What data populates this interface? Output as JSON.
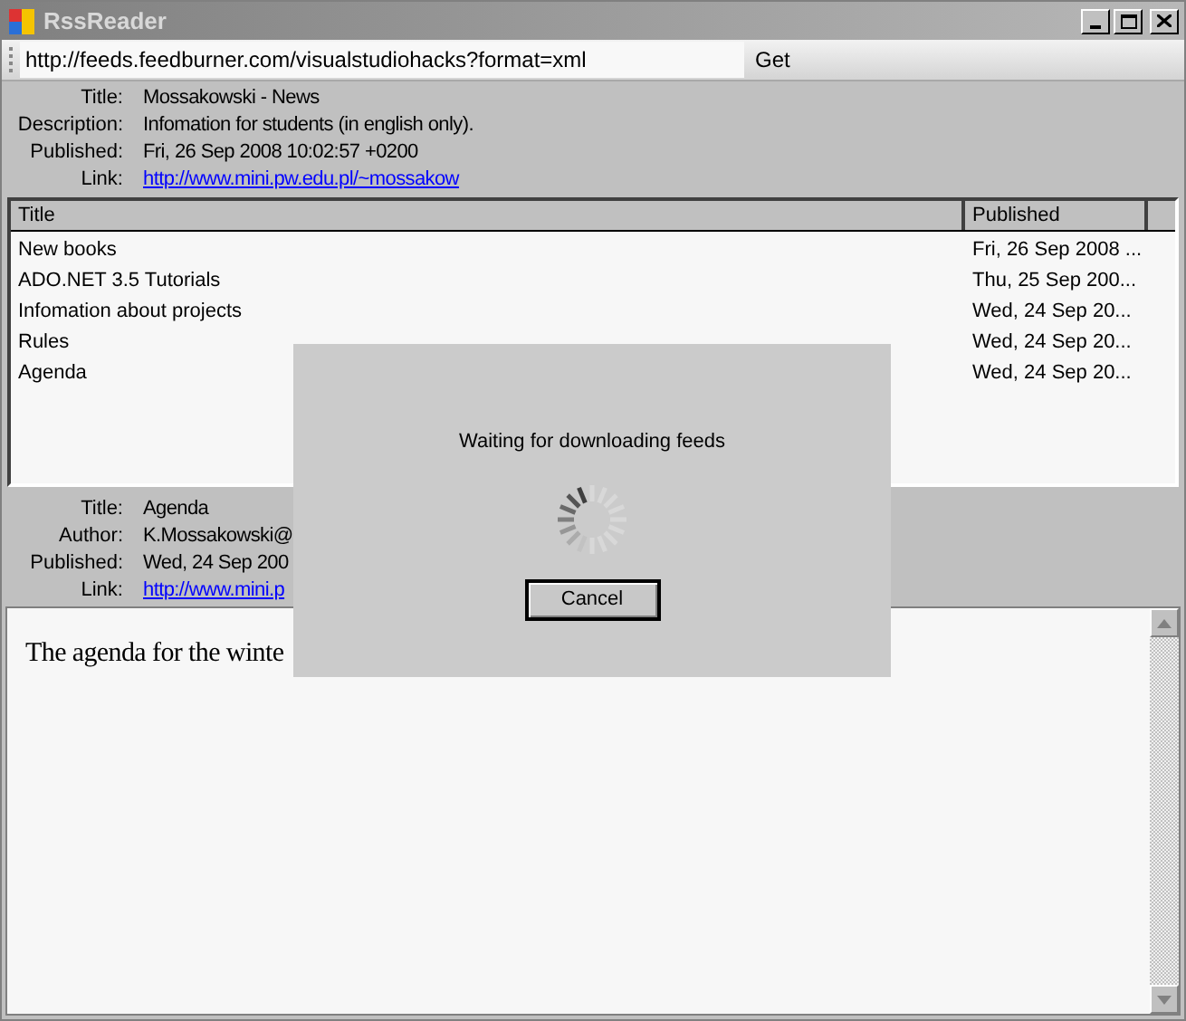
{
  "window": {
    "title": "RssReader"
  },
  "toolbar": {
    "url": "http://feeds.feedburner.com/visualstudiohacks?format=xml",
    "get_button": "Get"
  },
  "feed_info": [
    {
      "label": "Title:",
      "value": "Mossakowski - News",
      "kind": "text"
    },
    {
      "label": "Description:",
      "value": "Infomation for students (in english only).",
      "kind": "text"
    },
    {
      "label": "Published:",
      "value": "Fri, 26 Sep 2008 10:02:57 +0200",
      "kind": "text"
    },
    {
      "label": "Link:",
      "value": "http://www.mini.pw.edu.pl/~mossakow",
      "kind": "link"
    }
  ],
  "table": {
    "columns": [
      "Title",
      "Published"
    ],
    "rows": [
      {
        "title": "New books",
        "published": "Fri, 26 Sep 2008 ..."
      },
      {
        "title": "ADO.NET 3.5 Tutorials",
        "published": "Thu, 25 Sep 200..."
      },
      {
        "title": "Infomation about projects",
        "published": "Wed, 24 Sep 20..."
      },
      {
        "title": "Rules",
        "published": "Wed, 24 Sep 20..."
      },
      {
        "title": "Agenda",
        "published": "Wed, 24 Sep 20..."
      }
    ]
  },
  "item_info": [
    {
      "label": "Title:",
      "value": "Agenda",
      "kind": "text"
    },
    {
      "label": "Author:",
      "value": "K.Mossakowski@",
      "kind": "text"
    },
    {
      "label": "Published:",
      "value": "Wed, 24 Sep 200",
      "kind": "text"
    },
    {
      "label": "Link:",
      "value": "http://www.mini.p",
      "kind": "link"
    }
  ],
  "body": {
    "text": "The agenda for the winte"
  },
  "dialog": {
    "message": "Waiting for downloading feeds",
    "cancel_button": "Cancel"
  }
}
